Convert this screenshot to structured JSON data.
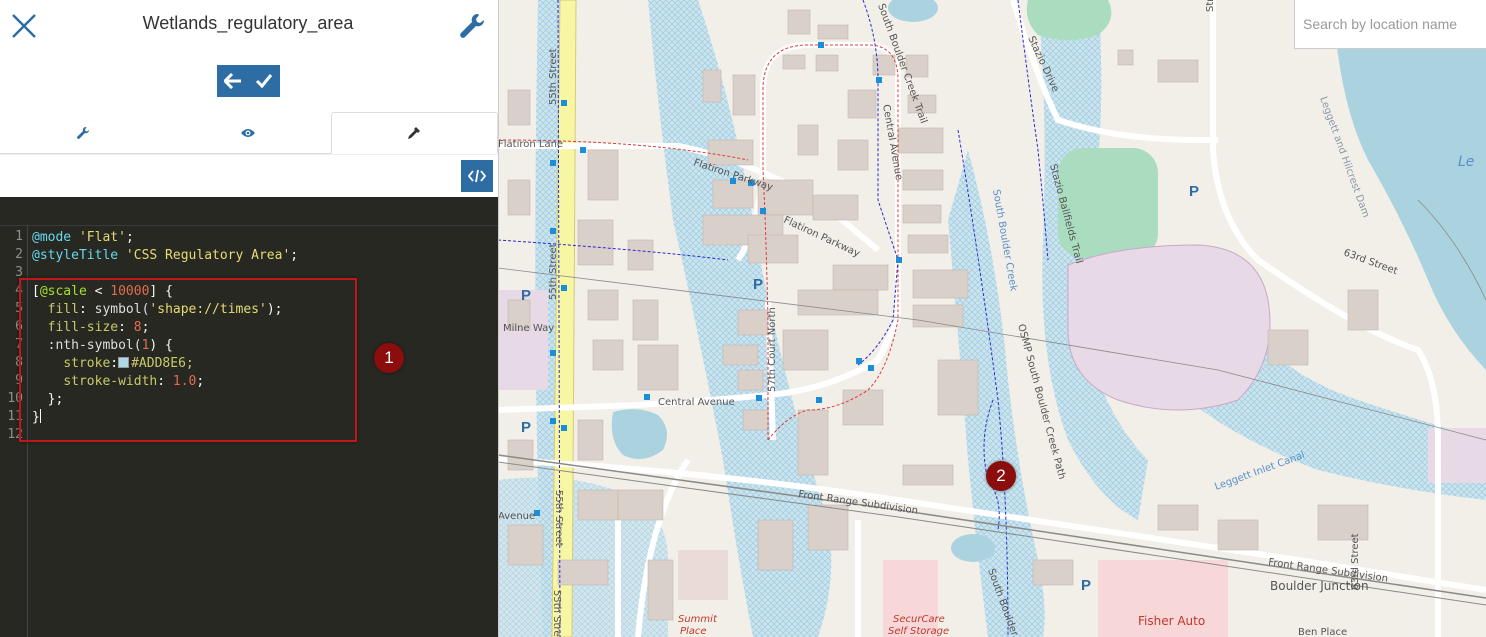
{
  "panel": {
    "layer_title": "Wetlands_regulatory_area",
    "close_icon": "close-icon",
    "settings_icon": "wrench-icon",
    "actions": {
      "back_icon": "arrow-left-icon",
      "apply_icon": "check-icon"
    },
    "tabs": [
      {
        "icon": "wrench-icon",
        "active": false
      },
      {
        "icon": "eye-icon",
        "active": false
      },
      {
        "icon": "eyedropper-icon",
        "active": true
      }
    ],
    "code_toggle_icon": "code-icon"
  },
  "editor": {
    "line_numbers": [
      "1",
      "2",
      "3",
      "4",
      "5",
      "6",
      "7",
      "8",
      "9",
      "10",
      "11",
      "12"
    ],
    "lines": {
      "l1_dir": "@mode",
      "l1_val": "'Flat'",
      "l2_dir": "@styleTitle",
      "l2_val": "'CSS Regulatory Area'",
      "l4_open": "[",
      "l4_dir": "@scale",
      "l4_op": " < ",
      "l4_num": "10000",
      "l4_close": "] {",
      "l5_prop": "fill",
      "l5_fn": "symbol(",
      "l5_str": "'shape://times'",
      "l5_end": ");",
      "l6_prop": "fill-size",
      "l6_num": "8",
      "l7_sel": ":nth-symbol(",
      "l7_num": "1",
      "l7_end": ") {",
      "l8_prop": "stroke",
      "l8_val": "#ADD8E6;",
      "l9_prop": "stroke-width",
      "l9_num": "1.0",
      "l10": "};",
      "l11": "}"
    },
    "swatch_color": "#ADD8E6"
  },
  "annotations": {
    "marker1": "1",
    "marker2": "2"
  },
  "search": {
    "placeholder": "Search by location name"
  },
  "map_labels": {
    "s55_a": "55th Street",
    "s55_b": "55th Street",
    "s55_c": "55th Street",
    "s55_d": "55th Street",
    "flatiron_lane": "Flatiron Lane",
    "flatiron_pkwy_a": "Flatiron Parkway",
    "flatiron_pkwy_b": "Flatiron Parkway",
    "central_ave_a": "Central Avenue",
    "central_ave_b": "Central Avenue",
    "milne_way": "Milne Way",
    "s57_court": "57th Court North",
    "south_boulder_trail": "South Boulder Creek Trail",
    "stazio_drive": "Stazio Drive",
    "stazio_fields": "Stazio Ballfields Trail",
    "osmp": "OSMP South Boulder Creek Path",
    "south_boulder_creek": "South Boulder Creek",
    "south_boulder_c2": "South Boulder Cre",
    "s63": "63rd Street",
    "s63b": "63rd Street",
    "leggett": "Leggett and Hilcrest Dam",
    "leggett_canal": "Leggett Inlet Canal",
    "front_range_a": "Front Range Subdivision",
    "front_range_b": "Front Range Subdivision",
    "boulder_junction": "Boulder Junction",
    "fisher_auto": "Fisher Auto",
    "securcare_1": "SecurCare",
    "securcare_2": "Self Storage",
    "summit_1": "Summit",
    "summit_2": "Place",
    "ben_place": "Ben Place",
    "avenue": "Avenue",
    "street_a": "Street",
    "le": "Le",
    "p": "P"
  }
}
